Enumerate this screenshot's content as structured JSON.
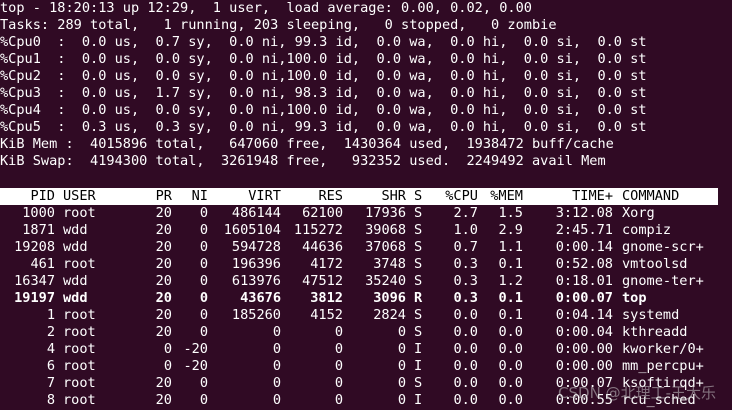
{
  "summary": [
    {
      "text": "top - 18:20:13 up 12:29,  1 user,  load average: 0.00, 0.02, 0.00"
    },
    {
      "text": "Tasks: 289 total,   1 running, 203 sleeping,   0 stopped,   0 zombie"
    },
    {
      "text": "%Cpu0  :  0.0 us,  0.7 sy,  0.0 ni, 99.3 id,  0.0 wa,  0.0 hi,  0.0 si,  0.0 st"
    },
    {
      "text": "%Cpu1  :  0.0 us,  0.0 sy,  0.0 ni,100.0 id,  0.0 wa,  0.0 hi,  0.0 si,  0.0 st"
    },
    {
      "text": "%Cpu2  :  0.0 us,  0.0 sy,  0.0 ni,100.0 id,  0.0 wa,  0.0 hi,  0.0 si,  0.0 st"
    },
    {
      "text": "%Cpu3  :  0.0 us,  1.7 sy,  0.0 ni, 98.3 id,  0.0 wa,  0.0 hi,  0.0 si,  0.0 st"
    },
    {
      "text": "%Cpu4  :  0.0 us,  0.0 sy,  0.0 ni,100.0 id,  0.0 wa,  0.0 hi,  0.0 si,  0.0 st"
    },
    {
      "text": "%Cpu5  :  0.3 us,  0.3 sy,  0.0 ni, 99.3 id,  0.0 wa,  0.0 hi,  0.0 si,  0.0 st"
    },
    {
      "text": "KiB Mem :  4015896 total,   647060 free,  1430364 used,  1938472 buff/cache"
    },
    {
      "text": "KiB Swap:  4194300 total,  3261948 free,   932352 used.  2249492 avail Mem"
    }
  ],
  "header": [
    "PID",
    "USER",
    "PR",
    "NI",
    "VIRT",
    "RES",
    "SHR",
    "S",
    "%CPU",
    "%MEM",
    "TIME+",
    "COMMAND"
  ],
  "processes": [
    {
      "pid": "1000",
      "user": "root",
      "pr": "20",
      "ni": "0",
      "virt": "486144",
      "res": "62100",
      "shr": "17936",
      "s": "S",
      "cpu": "2.7",
      "mem": "1.5",
      "time": "3:12.08",
      "cmd": "Xorg",
      "bold": false
    },
    {
      "pid": "1871",
      "user": "wdd",
      "pr": "20",
      "ni": "0",
      "virt": "1605104",
      "res": "115272",
      "shr": "39068",
      "s": "S",
      "cpu": "1.0",
      "mem": "2.9",
      "time": "2:45.71",
      "cmd": "compiz",
      "bold": false
    },
    {
      "pid": "19208",
      "user": "wdd",
      "pr": "20",
      "ni": "0",
      "virt": "594728",
      "res": "44636",
      "shr": "37068",
      "s": "S",
      "cpu": "0.7",
      "mem": "1.1",
      "time": "0:00.14",
      "cmd": "gnome-scr+",
      "bold": false
    },
    {
      "pid": "461",
      "user": "root",
      "pr": "20",
      "ni": "0",
      "virt": "196396",
      "res": "4172",
      "shr": "3748",
      "s": "S",
      "cpu": "0.3",
      "mem": "0.1",
      "time": "0:52.08",
      "cmd": "vmtoolsd",
      "bold": false
    },
    {
      "pid": "16347",
      "user": "wdd",
      "pr": "20",
      "ni": "0",
      "virt": "613976",
      "res": "47512",
      "shr": "35240",
      "s": "S",
      "cpu": "0.3",
      "mem": "1.2",
      "time": "0:18.01",
      "cmd": "gnome-ter+",
      "bold": false
    },
    {
      "pid": "19197",
      "user": "wdd",
      "pr": "20",
      "ni": "0",
      "virt": "43676",
      "res": "3812",
      "shr": "3096",
      "s": "R",
      "cpu": "0.3",
      "mem": "0.1",
      "time": "0:00.07",
      "cmd": "top",
      "bold": true
    },
    {
      "pid": "1",
      "user": "root",
      "pr": "20",
      "ni": "0",
      "virt": "185260",
      "res": "4152",
      "shr": "2824",
      "s": "S",
      "cpu": "0.0",
      "mem": "0.1",
      "time": "0:04.14",
      "cmd": "systemd",
      "bold": false
    },
    {
      "pid": "2",
      "user": "root",
      "pr": "20",
      "ni": "0",
      "virt": "0",
      "res": "0",
      "shr": "0",
      "s": "S",
      "cpu": "0.0",
      "mem": "0.0",
      "time": "0:00.04",
      "cmd": "kthreadd",
      "bold": false
    },
    {
      "pid": "4",
      "user": "root",
      "pr": "0",
      "ni": "-20",
      "virt": "0",
      "res": "0",
      "shr": "0",
      "s": "I",
      "cpu": "0.0",
      "mem": "0.0",
      "time": "0:00.00",
      "cmd": "kworker/0+",
      "bold": false
    },
    {
      "pid": "6",
      "user": "root",
      "pr": "0",
      "ni": "-20",
      "virt": "0",
      "res": "0",
      "shr": "0",
      "s": "I",
      "cpu": "0.0",
      "mem": "0.0",
      "time": "0:00.00",
      "cmd": "mm_percpu+",
      "bold": false
    },
    {
      "pid": "7",
      "user": "root",
      "pr": "20",
      "ni": "0",
      "virt": "0",
      "res": "0",
      "shr": "0",
      "s": "S",
      "cpu": "0.0",
      "mem": "0.0",
      "time": "0:00.07",
      "cmd": "ksoftirqd+",
      "bold": false
    },
    {
      "pid": "8",
      "user": "root",
      "pr": "20",
      "ni": "0",
      "virt": "0",
      "res": "0",
      "shr": "0",
      "s": "I",
      "cpu": "0.0",
      "mem": "0.0",
      "time": "0:00.55",
      "cmd": "rcu_sched",
      "bold": false
    }
  ],
  "watermark": "CSDN @北理工-王大乐",
  "colors": {
    "background": "#300a24",
    "text": "#ffffff",
    "header_bg": "#ffffff",
    "header_text": "#000000"
  }
}
